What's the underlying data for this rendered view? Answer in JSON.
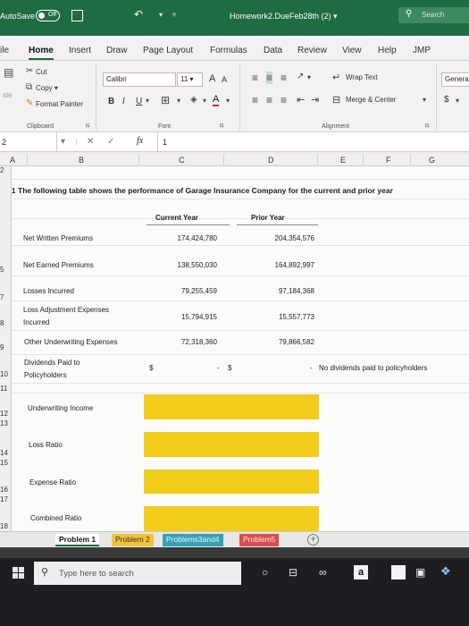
{
  "titlebar": {
    "autosave_label": "AutoSave",
    "autosave_state": "Off",
    "document_title": "Homework2.DueFeb28th (2) ▾",
    "search_label": "Search"
  },
  "tabs": [
    {
      "label": "ile",
      "active": false
    },
    {
      "label": "Home",
      "active": true
    },
    {
      "label": "Insert",
      "active": false
    },
    {
      "label": "Draw",
      "active": false
    },
    {
      "label": "Page Layout",
      "active": false
    },
    {
      "label": "Formulas",
      "active": false
    },
    {
      "label": "Data",
      "active": false
    },
    {
      "label": "Review",
      "active": false
    },
    {
      "label": "View",
      "active": false
    },
    {
      "label": "Help",
      "active": false
    },
    {
      "label": "JMP",
      "active": false
    }
  ],
  "ribbon": {
    "cut": "Cut",
    "copy": "Copy ▾",
    "format_painter": "Format Painter",
    "paste_partial": "ste",
    "font_name": "Calibri",
    "font_size": "11",
    "font_grow": "A",
    "font_shrink": "A",
    "bold": "B",
    "italic": "I",
    "underline": "U",
    "wrap_text": "Wrap Text",
    "merge_center": "Merge & Center",
    "number_format": "Genera",
    "currency": "$",
    "group_clipboard": "Clipboard",
    "group_font": "Font",
    "group_alignment": "Alignment"
  },
  "formula_bar": {
    "name_box": "2",
    "fx": "fx",
    "content": "1"
  },
  "columns": [
    "A",
    "B",
    "C",
    "D",
    "E",
    "F",
    "G"
  ],
  "rows": [
    "2",
    "",
    "",
    "",
    "5",
    "",
    "7",
    "8",
    "9",
    "10",
    "11",
    "12",
    "13",
    "14",
    "15",
    "16",
    "17",
    "18"
  ],
  "sheet": {
    "title_num": "1",
    "title": "The following table shows the performance of Garage Insurance Company for the current and prior year",
    "col_current": "Current Year",
    "col_prior": "Prior Year",
    "line_items": [
      {
        "label": "Net Written Premiums",
        "current": "174,424,780",
        "prior": "204,354,576"
      },
      {
        "label": "Net Earned Premiums",
        "current": "138,550,030",
        "prior": "164,892,997"
      },
      {
        "label": "Losses Incurred",
        "current": "79,255,459",
        "prior": "97,184,368"
      },
      {
        "label": "Loss Adjustment Expenses Incurred",
        "label_l1": "Loss Adjustment Expenses",
        "label_l2": "Incurred",
        "current": "15,794,915",
        "prior": "15,557,773"
      },
      {
        "label": "Other Underwriting Expenses",
        "current": "72,318,360",
        "prior": "79,866,582"
      }
    ],
    "dividends": {
      "label_l1": "Dividends Paid to",
      "label_l2": "Policyholders",
      "current_symbol": "$",
      "current_value": "-",
      "prior_symbol": "$",
      "prior_value": "-",
      "note": "No dividends paid to policyholders"
    },
    "ratios": [
      "Underwriting Income",
      "Loss Ratio",
      "Expense Ratio",
      "Combined Ratio"
    ],
    "answer_fill_color": "#f3cd1c"
  },
  "sheet_tabs": [
    {
      "label": "Problem 1",
      "color": "#ffffff"
    },
    {
      "label": "Problem 2",
      "color": "#f2c23a"
    },
    {
      "label": "Problems3and4",
      "color": "#38a1b8"
    },
    {
      "label": "Problem5",
      "color": "#d74f4f"
    }
  ],
  "taskbar": {
    "search_placeholder": "Type here to search",
    "amazon_letter": "a"
  }
}
